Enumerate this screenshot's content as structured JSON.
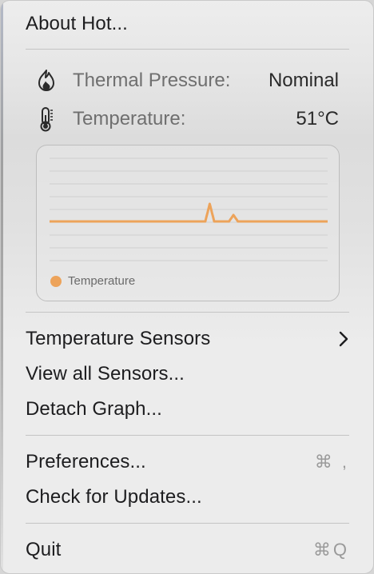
{
  "menu": {
    "about": "About Hot...",
    "thermal_pressure": {
      "label": "Thermal Pressure:",
      "value": "Nominal",
      "icon": "flame-icon"
    },
    "temperature": {
      "label": "Temperature:",
      "value": "51°C",
      "icon": "thermometer-icon"
    },
    "temperature_sensors": "Temperature Sensors",
    "view_all_sensors": "View all Sensors...",
    "detach_graph": "Detach Graph...",
    "preferences": {
      "label": "Preferences...",
      "shortcut": "⌘ ,"
    },
    "check_updates": "Check for Updates...",
    "quit": {
      "label": "Quit",
      "shortcut": "⌘Q"
    }
  },
  "colors": {
    "series": "#eda35a",
    "text": "#1d1d1f",
    "muted": "#6f6f6f"
  },
  "chart_data": {
    "type": "line",
    "series": [
      {
        "name": "Temperature",
        "values": [
          51,
          51,
          51,
          51,
          51,
          51,
          51,
          51,
          51,
          51,
          51,
          51,
          51,
          51,
          51,
          51,
          51,
          51,
          51,
          51,
          51,
          51,
          51,
          51,
          51,
          51,
          51,
          51,
          51,
          51,
          51,
          51,
          51,
          51,
          51,
          51,
          51,
          51,
          51,
          51,
          51,
          51,
          51,
          51,
          51,
          51,
          51,
          51,
          51,
          51,
          51,
          51,
          51,
          51,
          51,
          51,
          51,
          51,
          51,
          51,
          51,
          51,
          51,
          51,
          51,
          51,
          51,
          51,
          51,
          51,
          51,
          51,
          51,
          51,
          51,
          51,
          51,
          51,
          51,
          51,
          51,
          51,
          51,
          51,
          51,
          51,
          51,
          51,
          51,
          51,
          51,
          51,
          51,
          51,
          51,
          51,
          51,
          51,
          51,
          51,
          51,
          51,
          51,
          51,
          51,
          51,
          51,
          51,
          51,
          51,
          51,
          51,
          51,
          51,
          51,
          51,
          51,
          51,
          51,
          51,
          51,
          51,
          51,
          51,
          51,
          51,
          51,
          51,
          51,
          51,
          51,
          51,
          51,
          51,
          51,
          51,
          51,
          51,
          51,
          51,
          51,
          51,
          51,
          51,
          51,
          51,
          51,
          51,
          51,
          51,
          51,
          51,
          51,
          51,
          51,
          51,
          51,
          51,
          51,
          51,
          51,
          51,
          51,
          51,
          51,
          51,
          51,
          51,
          51,
          51,
          51,
          51,
          51,
          51,
          51,
          51,
          51,
          51,
          51,
          51,
          51,
          51,
          51,
          51,
          51,
          51,
          51,
          51,
          51,
          51,
          51,
          51,
          51,
          51,
          51,
          51,
          51,
          51,
          51,
          51,
          51,
          51,
          51,
          51,
          51,
          51,
          51,
          51,
          51,
          51,
          51,
          51,
          51,
          51,
          51,
          51,
          51,
          51,
          51,
          51,
          51,
          51,
          51,
          51,
          51,
          51,
          51,
          51,
          51,
          51,
          51,
          51,
          51,
          51,
          51,
          51,
          51,
          51,
          51,
          51,
          51,
          51,
          51,
          51,
          51,
          51,
          51,
          51,
          51,
          51,
          51,
          51,
          51,
          51,
          51,
          51,
          51,
          51,
          51,
          51,
          51,
          51,
          51,
          51,
          51,
          51,
          51,
          51,
          51,
          51,
          51,
          51,
          51,
          51,
          51,
          51,
          51,
          51,
          51,
          51,
          51,
          51,
          51,
          51,
          51,
          51,
          51,
          51,
          51,
          51,
          51,
          51,
          51,
          51,
          51,
          51,
          51,
          51,
          51,
          51,
          51,
          51,
          51,
          51,
          51,
          51,
          51,
          51,
          51,
          51,
          51,
          51,
          51,
          51,
          51,
          51,
          51,
          51,
          51,
          51,
          51,
          51,
          51,
          51,
          51,
          51,
          51,
          51,
          51,
          51,
          51,
          51,
          51,
          51,
          51,
          51,
          51,
          51,
          51,
          51,
          51,
          51,
          51,
          51,
          51,
          51,
          51,
          51,
          51,
          51,
          51,
          51,
          51,
          51,
          51,
          51,
          51,
          51,
          51,
          51,
          51,
          51,
          51,
          51,
          51,
          51,
          51,
          51,
          51,
          51,
          51,
          51,
          51,
          51,
          51,
          51
        ]
      }
    ],
    "spikes": [
      {
        "index_fraction": 0.577,
        "peak": 62
      },
      {
        "index_fraction": 0.66,
        "peak": 55
      }
    ],
    "ylim": [
      0,
      100
    ],
    "grid": true,
    "legend": "bottom-left",
    "title": "",
    "xlabel": "",
    "ylabel": ""
  }
}
